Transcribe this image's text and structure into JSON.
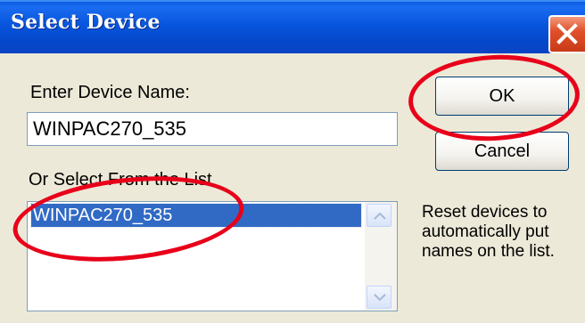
{
  "dialog": {
    "title": "Select Device",
    "device_name_label": "Enter Device Name:",
    "device_name_value": "WINPAC270_535",
    "list_label": "Or Select From the List",
    "list_items": [
      "WINPAC270_535"
    ],
    "ok_label": "OK",
    "cancel_label": "Cancel",
    "info_text": "Reset devices to automatically put names on the list."
  },
  "colors": {
    "titlebar": "#0855dd",
    "face": "#ece9d8",
    "selection": "#316ac5",
    "annotation": "#e8001a"
  }
}
